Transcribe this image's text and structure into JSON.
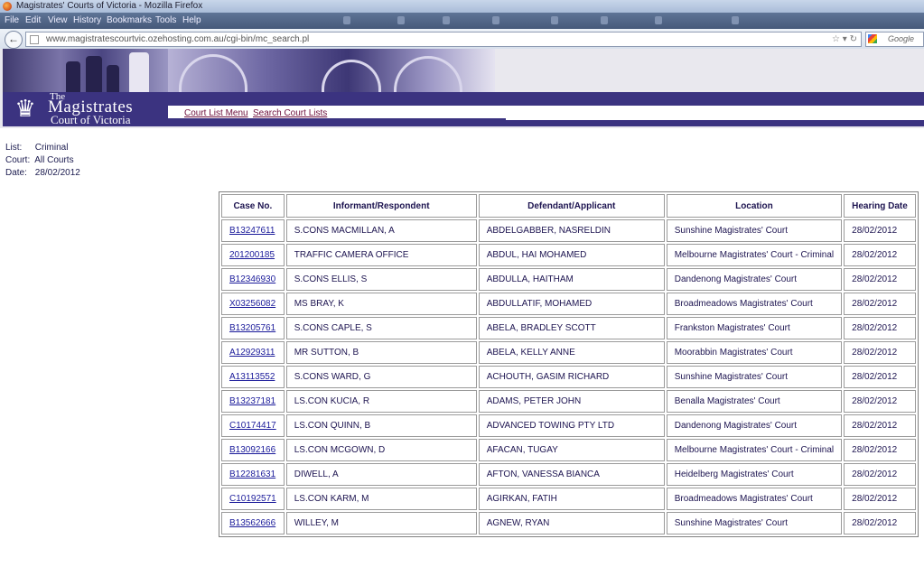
{
  "window": {
    "title": "Magistrates' Courts of Victoria - Mozilla Firefox"
  },
  "menu": {
    "items": [
      "File",
      "Edit",
      "View",
      "History",
      "Bookmarks",
      "Tools",
      "Help"
    ]
  },
  "navbar": {
    "url": "www.magistratescourtvic.ozehosting.com.au/cgi-bin/mc_search.pl",
    "search_placeholder": "Google"
  },
  "site": {
    "logo_the": "The",
    "logo_magistrates": "Magistrates",
    "logo_court": "Court of Victoria",
    "nav": [
      "Court List Menu",
      "Search Court Lists"
    ]
  },
  "info": {
    "list_label": "List:",
    "list_value": "Criminal",
    "court_label": "Court:",
    "court_value": "All Courts",
    "date_label": "Date:",
    "date_value": "28/02/2012"
  },
  "table": {
    "headers": [
      "Case No.",
      "Informant/Respondent",
      "Defendant/Applicant",
      "Location",
      "Hearing Date"
    ],
    "rows": [
      [
        "B13247611",
        "S.CONS MACMILLAN, A",
        "ABDELGABBER, NASRELDIN",
        "Sunshine Magistrates' Court",
        "28/02/2012"
      ],
      [
        "201200185",
        "TRAFFIC CAMERA OFFICE",
        "ABDUL, HAI MOHAMED",
        "Melbourne Magistrates' Court - Criminal",
        "28/02/2012"
      ],
      [
        "B12346930",
        "S.CONS ELLIS, S",
        "ABDULLA, HAITHAM",
        "Dandenong Magistrates' Court",
        "28/02/2012"
      ],
      [
        "X03256082",
        "MS BRAY, K",
        "ABDULLATIF, MOHAMED",
        "Broadmeadows Magistrates' Court",
        "28/02/2012"
      ],
      [
        "B13205761",
        "S.CONS CAPLE, S",
        "ABELA, BRADLEY SCOTT",
        "Frankston Magistrates' Court",
        "28/02/2012"
      ],
      [
        "A12929311",
        "MR SUTTON, B",
        "ABELA, KELLY ANNE",
        "Moorabbin Magistrates' Court",
        "28/02/2012"
      ],
      [
        "A13113552",
        "S.CONS WARD, G",
        "ACHOUTH, GASIM RICHARD",
        "Sunshine Magistrates' Court",
        "28/02/2012"
      ],
      [
        "B13237181",
        "LS.CON KUCIA, R",
        "ADAMS, PETER JOHN",
        "Benalla Magistrates' Court",
        "28/02/2012"
      ],
      [
        "C10174417",
        "LS.CON QUINN, B",
        "ADVANCED TOWING PTY LTD",
        "Dandenong Magistrates' Court",
        "28/02/2012"
      ],
      [
        "B13092166",
        "LS.CON MCGOWN, D",
        "AFACAN, TUGAY",
        "Melbourne Magistrates' Court - Criminal",
        "28/02/2012"
      ],
      [
        "B12281631",
        "DIWELL, A",
        "AFTON, VANESSA BIANCA",
        "Heidelberg Magistrates' Court",
        "28/02/2012"
      ],
      [
        "C10192571",
        "LS.CON KARM, M",
        "AGIRKAN, FATIH",
        "Broadmeadows Magistrates' Court",
        "28/02/2012"
      ],
      [
        "B13562666",
        "WILLEY, M",
        "AGNEW, RYAN",
        "Sunshine Magistrates' Court",
        "28/02/2012"
      ]
    ]
  }
}
